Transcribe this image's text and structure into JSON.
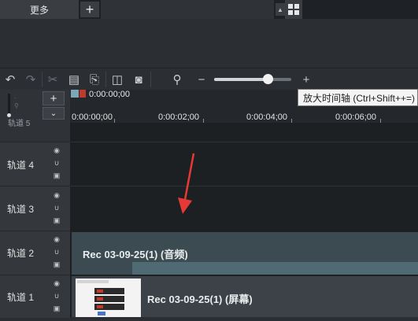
{
  "tabs": {
    "more_label": "更多",
    "add_label": "+"
  },
  "toolbar": {
    "zoom_out_label": "−",
    "zoom_in_label": "+",
    "zoom_level": 0.7
  },
  "tooltip": {
    "text": "放大时间轴 (Ctrl+Shift++=)"
  },
  "timeline": {
    "playhead_time": "0:00:00;00",
    "ticks": [
      "0:00:00;00",
      "0:00:02;00",
      "0:00:04;00",
      "0:00:06;00"
    ],
    "add_track_label": "+"
  },
  "tracks": [
    {
      "name": "轨道 4"
    },
    {
      "name": "轨道 3"
    },
    {
      "name": "轨道 2"
    },
    {
      "name": "轨道 1"
    }
  ],
  "top_track_cut_label": "轨道 5",
  "clips": {
    "audio_title": "Rec 03-09-25(1) (音频)",
    "video_title": "Rec 03-09-25(1) (屏幕)"
  },
  "colors": {
    "accent_red": "#c0392b",
    "arrow_red": "#e53935"
  }
}
